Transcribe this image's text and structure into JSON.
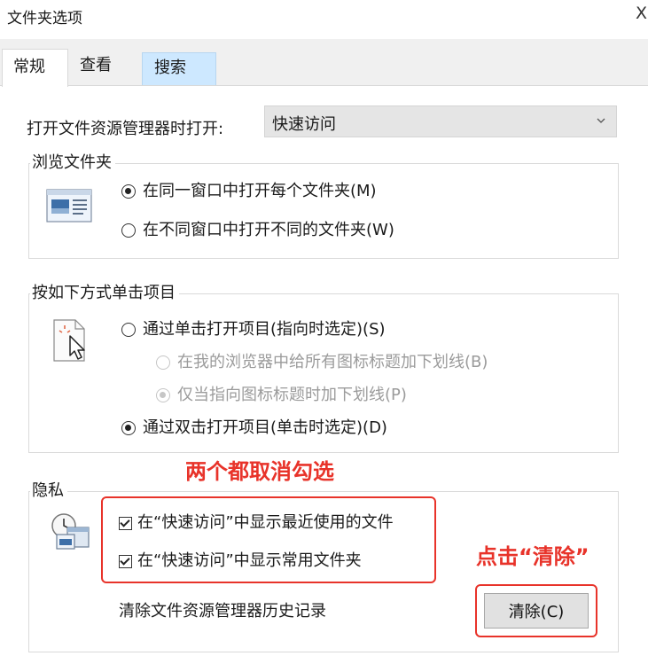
{
  "window": {
    "title": "文件夹选项",
    "close_glyph": "X"
  },
  "tabs": [
    {
      "label": "常规",
      "active": true
    },
    {
      "label": "查看",
      "active": false
    },
    {
      "label": "搜索",
      "active": false
    }
  ],
  "general": {
    "open_label": "打开文件资源管理器时打开:",
    "open_value": "快速访问",
    "browse_group": {
      "title": "浏览文件夹",
      "options": [
        {
          "label": "在同一窗口中打开每个文件夹(M)",
          "selected": true
        },
        {
          "label": "在不同窗口中打开不同的文件夹(W)",
          "selected": false
        }
      ]
    },
    "click_group": {
      "title": "按如下方式单击项目",
      "single_click": {
        "label": "通过单击打开项目(指向时选定)(S)",
        "selected": false
      },
      "underline_options": [
        {
          "label": "在我的浏览器中给所有图标标题加下划线(B)",
          "selected": false,
          "enabled": false
        },
        {
          "label": "仅当指向图标标题时加下划线(P)",
          "selected": true,
          "enabled": false
        }
      ],
      "double_click": {
        "label": "通过双击打开项目(单击时选定)(D)",
        "selected": true
      }
    },
    "privacy_group": {
      "title": "隐私",
      "checkboxes": [
        {
          "label": "在“快速访问”中显示最近使用的文件",
          "checked": true
        },
        {
          "label": "在“快速访问”中显示常用文件夹",
          "checked": true
        }
      ],
      "clear_history_label": "清除文件资源管理器历史记录",
      "clear_button": "清除(C)"
    }
  },
  "annotations": {
    "uncheck_both": "两个都取消勾选",
    "click_clear": "点击“清除”",
    "color": "#e8332a"
  }
}
